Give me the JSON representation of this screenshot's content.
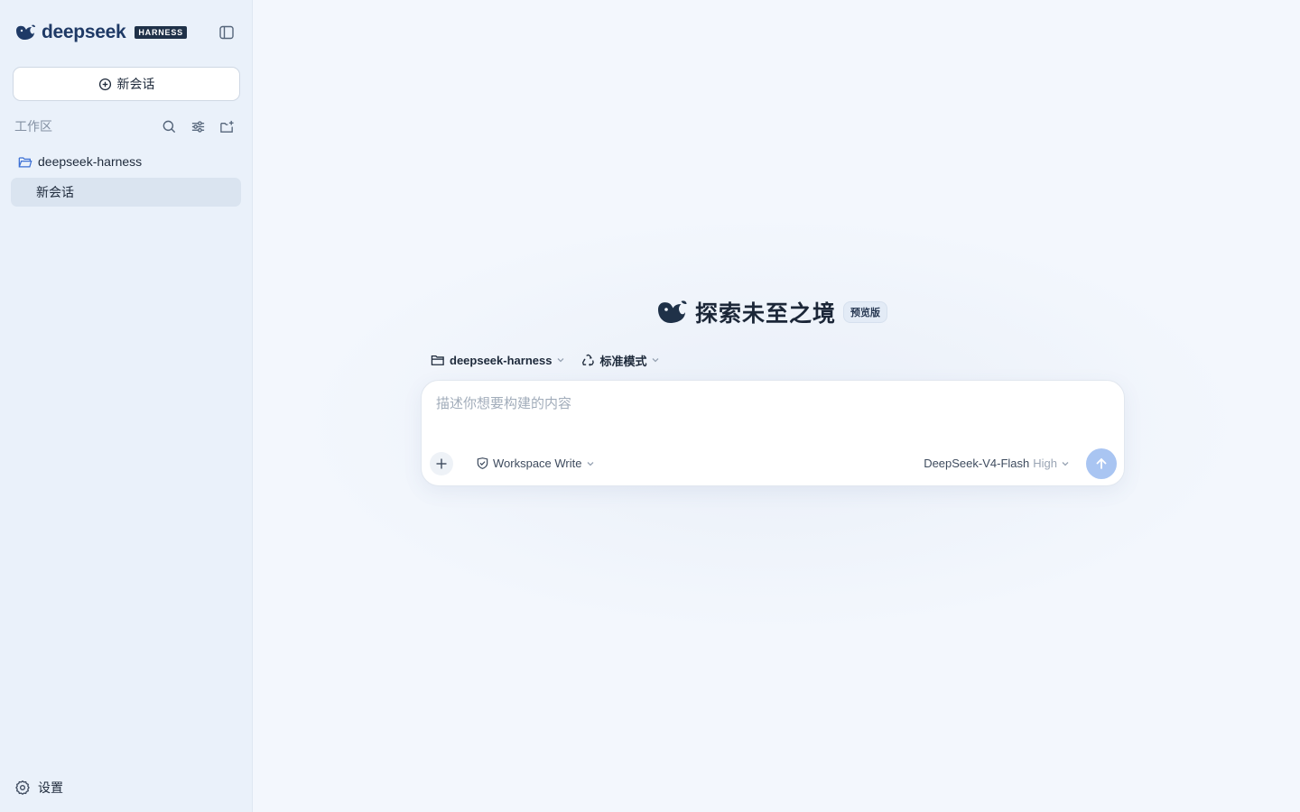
{
  "brand": {
    "name": "deepseek",
    "tag": "HARNESS"
  },
  "sidebar": {
    "new_chat_label": "新会话",
    "workspace_label": "工作区",
    "project_name": "deepseek-harness",
    "sessions": [
      {
        "label": "新会话"
      }
    ],
    "settings_label": "设置"
  },
  "hero": {
    "title": "探索未至之境",
    "badge": "预览版"
  },
  "selectors": {
    "project": "deepseek-harness",
    "mode": "标准模式"
  },
  "composer": {
    "placeholder": "描述你想要构建的内容",
    "value": "",
    "permission": "Workspace Write",
    "model_name": "DeepSeek-V4-Flash",
    "model_level": "High"
  },
  "colors": {
    "accent": "#a9c5f2",
    "sidebar_bg": "#eaf1fa",
    "main_bg": "#f3f7fd",
    "brand_blue": "#1f3a66"
  }
}
